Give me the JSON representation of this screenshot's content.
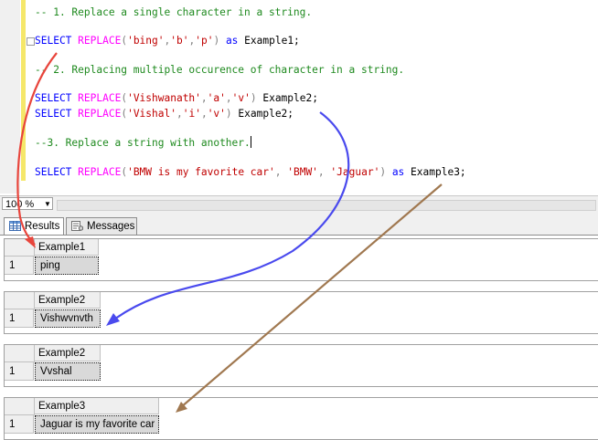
{
  "editor": {
    "lines": [
      {
        "comment": "-- 1. Replace a single character in a string."
      },
      {
        "kw": "SELECT",
        "fn": "REPLACE",
        "lp": "(",
        "s1": "'bing'",
        "c1": ",",
        "s2": "'b'",
        "c2": ",",
        "s3": "'p'",
        "rp": ")",
        "as": "as",
        "alias": "Example1;"
      },
      {
        "comment": "-- 2. Replacing multiple occurence of character in a string."
      },
      {
        "kw": "SELECT",
        "fn": "REPLACE",
        "lp": "(",
        "s1": "'Vishwanath'",
        "c1": ",",
        "s2": "'a'",
        "c2": ",",
        "s3": "'v'",
        "rp": ")",
        "alias": "Example2;"
      },
      {
        "kw": "SELECT",
        "fn": "REPLACE",
        "lp": "(",
        "s1": "'Vishal'",
        "c1": ",",
        "s2": "'i'",
        "c2": ",",
        "s3": "'v'",
        "rp": ")",
        "alias": "Example2;"
      },
      {
        "comment": "--3. Replace a string with another."
      },
      {
        "kw": "SELECT",
        "fn": "REPLACE",
        "lp": "(",
        "s1": "'BMW is my favorite car'",
        "c1": ",",
        "s2": "'BMW'",
        "c2": ",",
        "s3": "'Jaguar'",
        "rp": ")",
        "as": "as",
        "alias": "Example3;"
      }
    ]
  },
  "status": {
    "zoom": "100 %"
  },
  "tabs": {
    "results": "Results",
    "messages": "Messages"
  },
  "results": [
    {
      "column": "Example1",
      "row_number": "1",
      "value": "ping"
    },
    {
      "column": "Example2",
      "row_number": "1",
      "value": "Vishwvnvth"
    },
    {
      "column": "Example2",
      "row_number": "1",
      "value": "Vvshal"
    },
    {
      "column": "Example3",
      "row_number": "1",
      "value": "Jaguar is my favorite car"
    }
  ],
  "annotation_colors": {
    "arrow1": "#e8453c",
    "arrow2": "#4a4aee",
    "arrow3": "#a07850"
  }
}
